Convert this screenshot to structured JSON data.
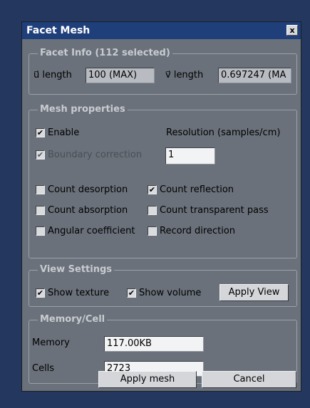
{
  "window": {
    "title": "Facet Mesh",
    "close_glyph": "x"
  },
  "facet_info": {
    "title": "Facet Info (112 selected)",
    "u_label": "u⃗ length",
    "u_value": "100 (MAX)",
    "v_label": "v⃗ length",
    "v_value": "0.697247 (MA"
  },
  "mesh": {
    "title": "Mesh properties",
    "enable_label": "Enable",
    "resolution_label": "Resolution (samples/cm)",
    "boundary_label": "Boundary correction",
    "resolution_value": "1",
    "count_desorption": "Count desorption",
    "count_reflection": "Count reflection",
    "count_absorption": "Count absorption",
    "count_transparent": "Count transparent pass",
    "angular_coefficient": "Angular coefficient",
    "record_direction": "Record direction",
    "check_glyph": "✔"
  },
  "view": {
    "title": "View Settings",
    "show_texture": "Show texture",
    "show_volume": "Show volume",
    "apply_view": "Apply View"
  },
  "memory": {
    "title": "Memory/Cell",
    "memory_label": "Memory",
    "memory_value": "117.00KB",
    "cells_label": "Cells",
    "cells_value": "2723"
  },
  "footer": {
    "apply_mesh": "Apply mesh",
    "cancel": "Cancel"
  }
}
